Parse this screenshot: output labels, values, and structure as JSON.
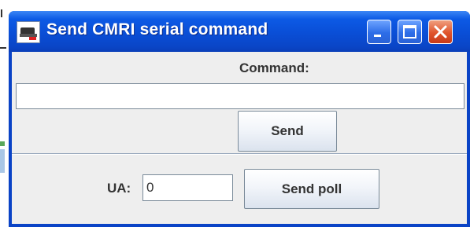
{
  "window": {
    "title": "Send CMRI serial command",
    "app_icon": "locomotive-icon",
    "controls": [
      "minimize-icon",
      "maximize-icon",
      "close-icon"
    ]
  },
  "command": {
    "label": "Command:",
    "value": "",
    "send_label": "Send"
  },
  "poll": {
    "ua_label": "UA:",
    "ua_value": "0",
    "send_poll_label": "Send poll"
  },
  "colors": {
    "titlebar": "#0a4ed6",
    "close_button": "#e0542c",
    "panel": "#eeeeee"
  }
}
